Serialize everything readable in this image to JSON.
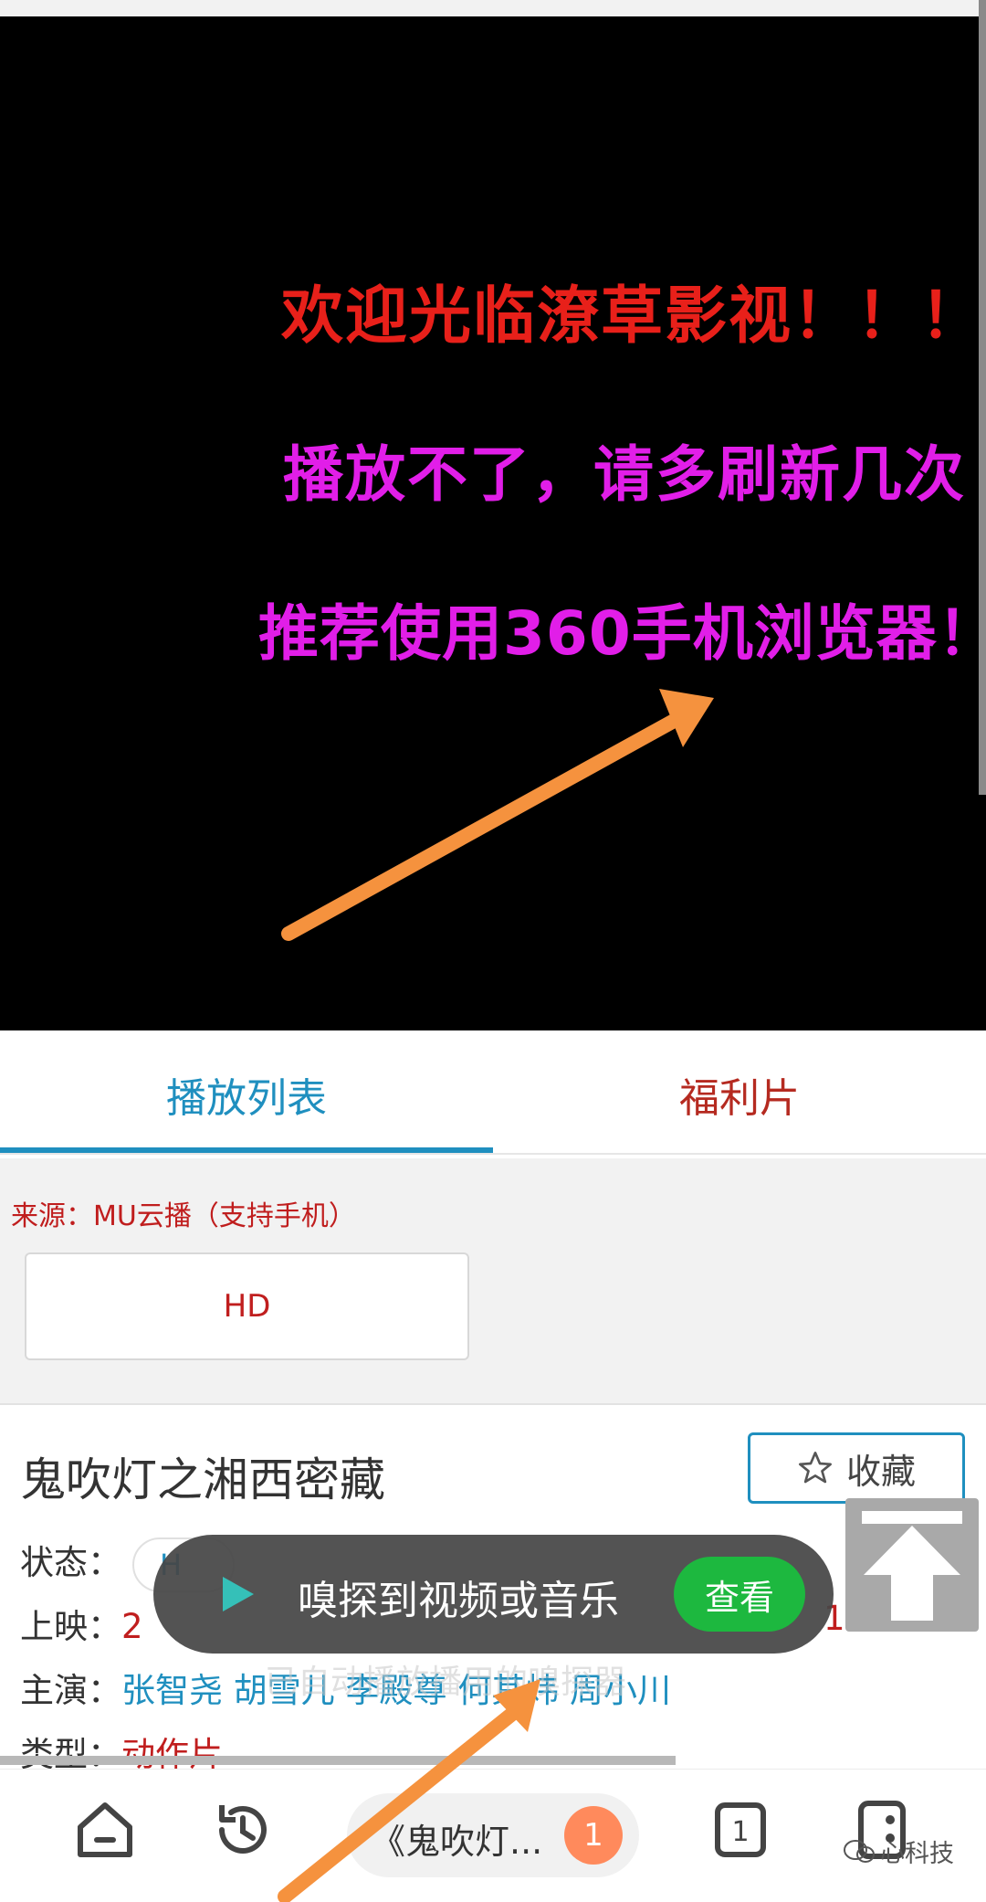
{
  "video": {
    "line1": "欢迎光临潦草影视！！！",
    "line2": "播放不了，请多刷新几次",
    "line3": "推荐使用360手机浏览器！"
  },
  "tabs": {
    "playlist": "播放列表",
    "welfare": "福利片",
    "active": "playlist"
  },
  "source": {
    "label": "来源：MU云播（支持手机）",
    "episode": "HD"
  },
  "movie": {
    "title": "鬼吹灯之湘西密藏",
    "favorite": "收藏",
    "status_label": "状态：",
    "status_value": "H",
    "release_label": "上映：",
    "release_prefix": "2",
    "release_time": "18:44",
    "actors_label": "主演：",
    "actors": "张智尧 胡雪儿 李殿尊 何其炜 周小川",
    "genre_label": "类型：",
    "genre": "动作片"
  },
  "toast": {
    "message": "嗅探到视频或音乐",
    "action": "查看",
    "subtext": "已自动播放播用的嗅探器"
  },
  "bottom_bar": {
    "address": "《鬼吹灯...",
    "badge_count": "1",
    "tab_count": "1",
    "watermark": "心科技"
  },
  "colors": {
    "accent_blue": "#1f8fbf",
    "accent_red": "#c01e1e",
    "video_red": "#e8201a",
    "video_magenta": "#e11ee8",
    "annotation_arrow": "#f5923e",
    "toast_green": "#1db83f"
  }
}
